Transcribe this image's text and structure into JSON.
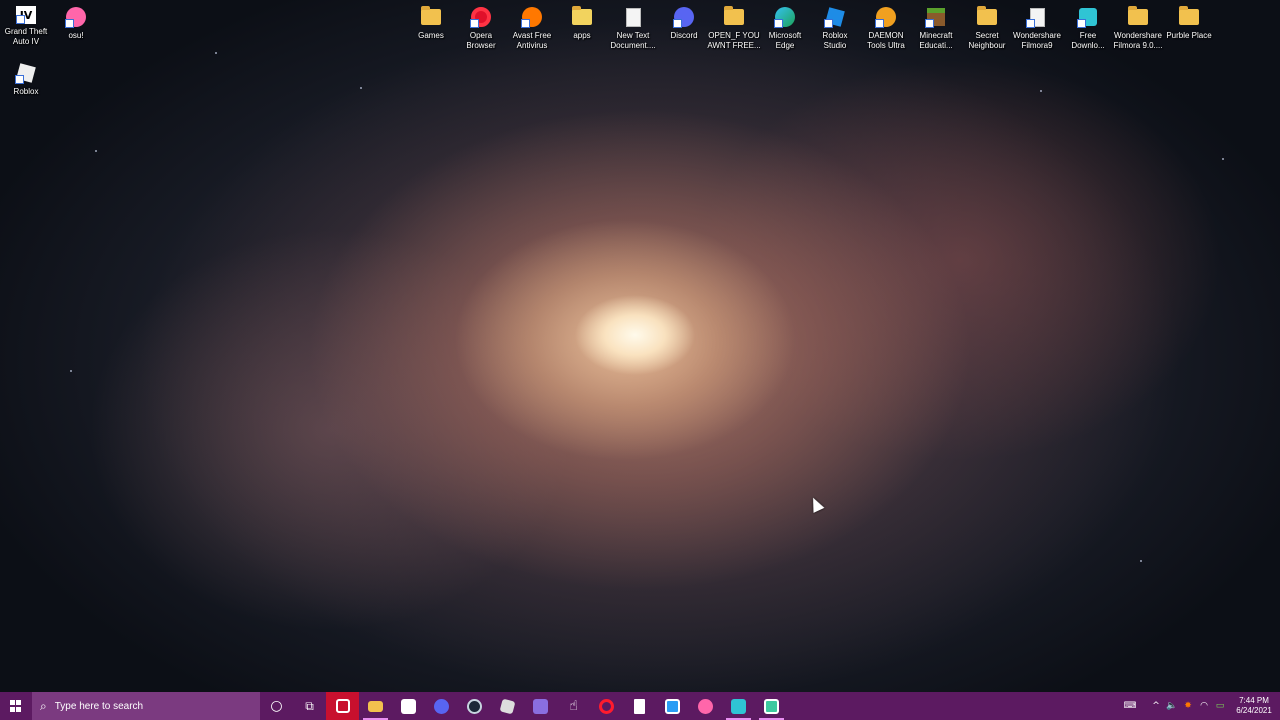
{
  "desktop": {
    "left_icons": [
      {
        "label": "Grand Theft\nAuto IV",
        "icon": "gta-icon"
      },
      {
        "label": "osu!",
        "icon": "osu-icon"
      },
      {
        "label": "Roblox",
        "icon": "roblox-icon"
      }
    ],
    "top_icons": [
      {
        "label": "Games",
        "icon": "folder-icon"
      },
      {
        "label": "Opera\nBrowser",
        "icon": "opera-icon"
      },
      {
        "label": "Avast Free\nAntivirus",
        "icon": "avast-icon"
      },
      {
        "label": "apps",
        "icon": "folder-icon"
      },
      {
        "label": "New Text\nDocument....",
        "icon": "text-document-icon"
      },
      {
        "label": "Discord",
        "icon": "discord-icon"
      },
      {
        "label": "OPEN_F YOU\nAWNT FREE...",
        "icon": "folder-icon"
      },
      {
        "label": "Microsoft\nEdge",
        "icon": "edge-icon"
      },
      {
        "label": "Roblox\nStudio",
        "icon": "roblox-studio-icon"
      },
      {
        "label": "DAEMON\nTools Ultra",
        "icon": "daemon-tools-icon"
      },
      {
        "label": "Minecraft\nEducati...",
        "icon": "minecraft-icon"
      },
      {
        "label": "Secret\nNeighbour",
        "icon": "folder-icon"
      },
      {
        "label": "Wondershare\nFilmora9",
        "icon": "filmora-icon"
      },
      {
        "label": "Free\nDownlo...",
        "icon": "free-download-icon"
      },
      {
        "label": "Wondershare\nFilmora 9.0....",
        "icon": "folder-icon"
      },
      {
        "label": "Purble Place",
        "icon": "folder-icon"
      }
    ]
  },
  "taskbar": {
    "search_placeholder": "Type here to search",
    "apps": [
      {
        "name": "cortana-icon",
        "glyph": "○"
      },
      {
        "name": "task-view-icon",
        "glyph": "⧉"
      },
      {
        "name": "opera-gx-icon",
        "glyph": "O"
      },
      {
        "name": "file-explorer-icon",
        "glyph": ""
      },
      {
        "name": "microsoft-store-icon",
        "glyph": ""
      },
      {
        "name": "discord-icon",
        "glyph": ""
      },
      {
        "name": "steam-icon",
        "glyph": ""
      },
      {
        "name": "roblox-icon",
        "glyph": ""
      },
      {
        "name": "visual-studio-icon",
        "glyph": ""
      },
      {
        "name": "pointer-app-icon",
        "glyph": ""
      },
      {
        "name": "opera-icon",
        "glyph": ""
      },
      {
        "name": "notepad-icon",
        "glyph": ""
      },
      {
        "name": "filmora-icon",
        "glyph": ""
      },
      {
        "name": "osu-icon",
        "glyph": ""
      },
      {
        "name": "free-download-icon",
        "glyph": ""
      },
      {
        "name": "minecraft-icon",
        "glyph": ""
      }
    ],
    "tray": {
      "time": "7:44 PM",
      "date": "6/24/2021"
    }
  },
  "colors": {
    "taskbar": "#5c1a61",
    "search_box": "#7b3a80",
    "active_app": "#c8102e"
  }
}
